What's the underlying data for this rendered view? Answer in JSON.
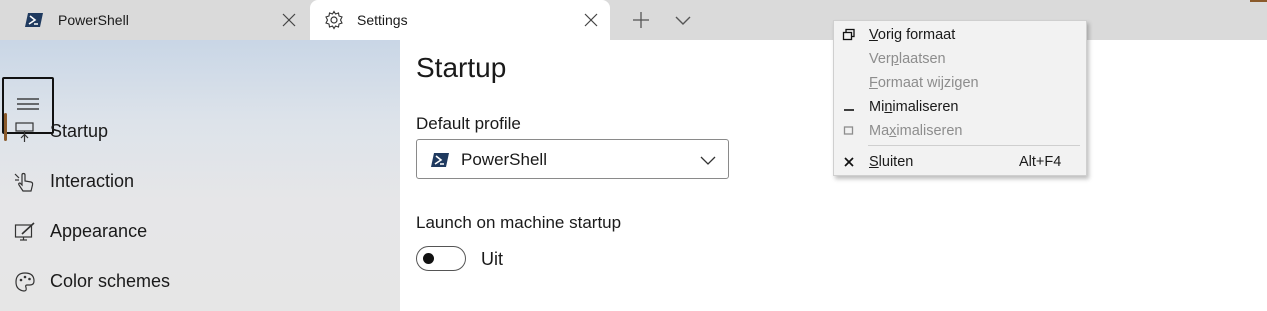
{
  "tabs": [
    {
      "label": "PowerShell",
      "icon": "powershell-icon"
    },
    {
      "label": "Settings",
      "icon": "gear-icon",
      "active": true
    }
  ],
  "sidebar": {
    "menu_icon": "hamburger-icon",
    "items": [
      {
        "label": "Startup",
        "icon": "startup-icon",
        "selected": true
      },
      {
        "label": "Interaction",
        "icon": "pointer-hand-icon"
      },
      {
        "label": "Appearance",
        "icon": "appearance-edit-icon"
      },
      {
        "label": "Color schemes",
        "icon": "palette-icon"
      }
    ]
  },
  "main": {
    "title": "Startup",
    "default_profile_label": "Default profile",
    "default_profile_value": "PowerShell",
    "launch_label": "Launch on machine startup",
    "launch_state": "Uit"
  },
  "context_menu": {
    "items": [
      {
        "pre": "",
        "key": "V",
        "post": "orig formaat",
        "enabled": true,
        "icon": "restore-icon"
      },
      {
        "pre": "Ver",
        "key": "p",
        "post": "laatsen",
        "enabled": false
      },
      {
        "pre": "",
        "key": "F",
        "post": "ormaat wijzigen",
        "enabled": false
      },
      {
        "pre": "Mi",
        "key": "n",
        "post": "imaliseren",
        "enabled": true,
        "icon": "minimize-icon"
      },
      {
        "pre": "Ma",
        "key": "x",
        "post": "imaliseren",
        "enabled": false,
        "icon": "maximize-icon"
      },
      {
        "pre": "",
        "key": "S",
        "post": "luiten",
        "enabled": true,
        "icon": "close-x-icon",
        "shortcut": "Alt+F4"
      }
    ]
  },
  "colors": {
    "accent": "#8a5a2b",
    "tab_bar": "#dadada",
    "menu_bg": "#f2f2f2",
    "disabled_text": "#8d8d8d"
  }
}
